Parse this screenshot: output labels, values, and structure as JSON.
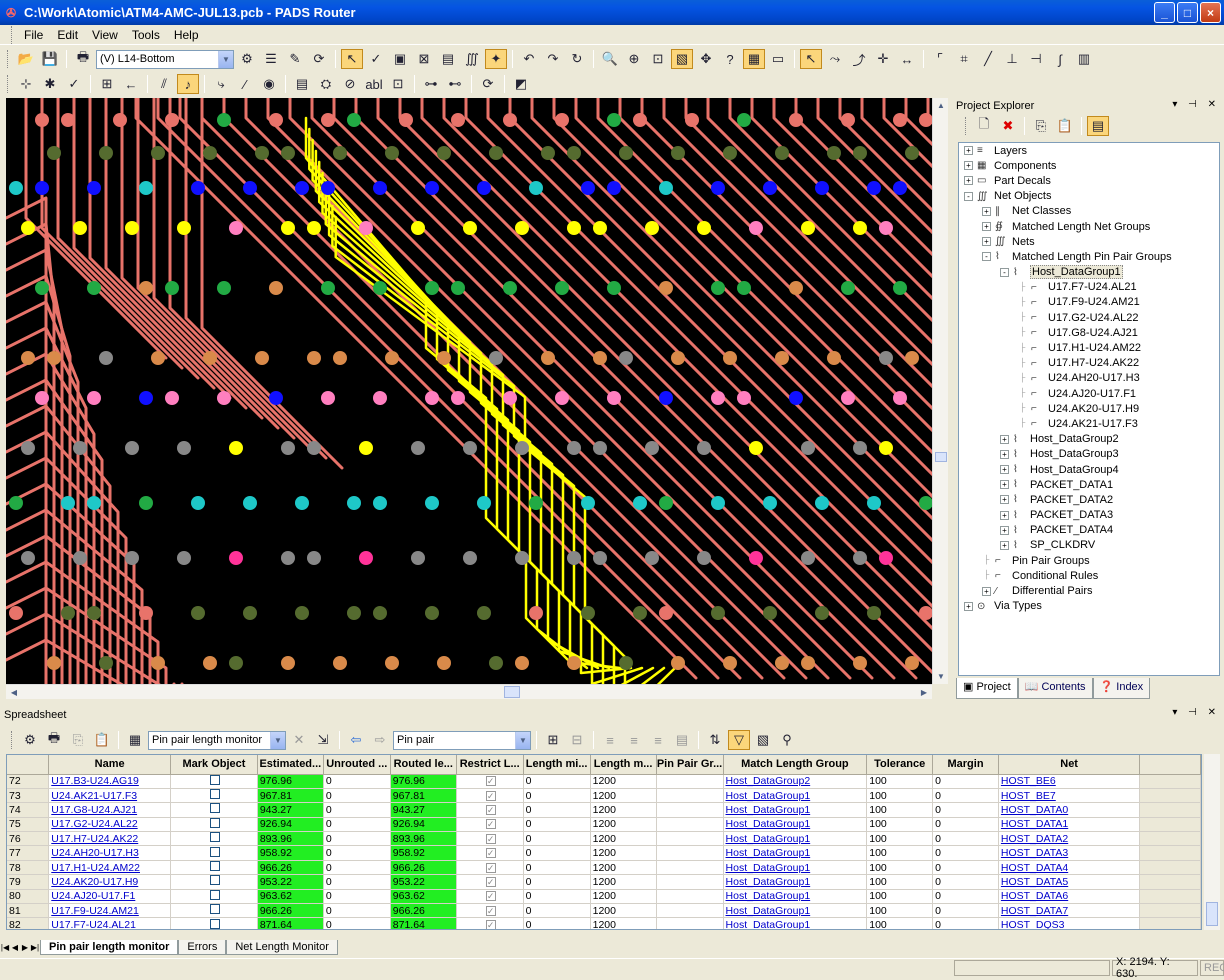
{
  "window": {
    "title": "C:\\Work\\Atomic\\ATM4-AMC-JUL13.pcb - PADS Router",
    "min": "_",
    "max": "□",
    "close": "×"
  },
  "menu": [
    "File",
    "Edit",
    "View",
    "Tools",
    "Help"
  ],
  "layer_combo": {
    "value": "(V) L14-Bottom"
  },
  "project_explorer": {
    "title": "Project Explorer",
    "tree": [
      {
        "level": 0,
        "exp": "+",
        "icon": "layers-icon",
        "glyph": "≡",
        "label": "Layers"
      },
      {
        "level": 0,
        "exp": "+",
        "icon": "components-icon",
        "glyph": "▦",
        "label": "Components"
      },
      {
        "level": 0,
        "exp": "+",
        "icon": "part-decals-icon",
        "glyph": "▭",
        "label": "Part Decals"
      },
      {
        "level": 0,
        "exp": "-",
        "icon": "net-objects-icon",
        "glyph": "∭",
        "label": "Net Objects"
      },
      {
        "level": 1,
        "exp": "+",
        "icon": "net-classes-icon",
        "glyph": "∥",
        "label": "Net Classes"
      },
      {
        "level": 1,
        "exp": "+",
        "icon": "ml-net-groups-icon",
        "glyph": "∯",
        "label": "Matched Length Net Groups"
      },
      {
        "level": 1,
        "exp": "+",
        "icon": "nets-icon",
        "glyph": "∭",
        "label": "Nets"
      },
      {
        "level": 1,
        "exp": "-",
        "icon": "ml-pin-pair-groups-icon",
        "glyph": "⌇",
        "label": "Matched Length Pin Pair Groups"
      },
      {
        "level": 2,
        "exp": "-",
        "icon": "pin-pair-group-icon",
        "glyph": "⌇",
        "label": "Host_DataGroup1",
        "selected": true
      },
      {
        "level": 3,
        "exp": "",
        "icon": "pin-pair-icon",
        "glyph": "⌐",
        "label": "U17.F7-U24.AL21"
      },
      {
        "level": 3,
        "exp": "",
        "icon": "pin-pair-icon",
        "glyph": "⌐",
        "label": "U17.F9-U24.AM21"
      },
      {
        "level": 3,
        "exp": "",
        "icon": "pin-pair-icon",
        "glyph": "⌐",
        "label": "U17.G2-U24.AL22"
      },
      {
        "level": 3,
        "exp": "",
        "icon": "pin-pair-icon",
        "glyph": "⌐",
        "label": "U17.G8-U24.AJ21"
      },
      {
        "level": 3,
        "exp": "",
        "icon": "pin-pair-icon",
        "glyph": "⌐",
        "label": "U17.H1-U24.AM22"
      },
      {
        "level": 3,
        "exp": "",
        "icon": "pin-pair-icon",
        "glyph": "⌐",
        "label": "U17.H7-U24.AK22"
      },
      {
        "level": 3,
        "exp": "",
        "icon": "pin-pair-icon",
        "glyph": "⌐",
        "label": "U24.AH20-U17.H3"
      },
      {
        "level": 3,
        "exp": "",
        "icon": "pin-pair-icon",
        "glyph": "⌐",
        "label": "U24.AJ20-U17.F1"
      },
      {
        "level": 3,
        "exp": "",
        "icon": "pin-pair-icon",
        "glyph": "⌐",
        "label": "U24.AK20-U17.H9"
      },
      {
        "level": 3,
        "exp": "",
        "icon": "pin-pair-icon",
        "glyph": "⌐",
        "label": "U24.AK21-U17.F3"
      },
      {
        "level": 2,
        "exp": "+",
        "icon": "pin-pair-group-icon",
        "glyph": "⌇",
        "label": "Host_DataGroup2"
      },
      {
        "level": 2,
        "exp": "+",
        "icon": "pin-pair-group-icon",
        "glyph": "⌇",
        "label": "Host_DataGroup3"
      },
      {
        "level": 2,
        "exp": "+",
        "icon": "pin-pair-group-icon",
        "glyph": "⌇",
        "label": "Host_DataGroup4"
      },
      {
        "level": 2,
        "exp": "+",
        "icon": "pin-pair-group-icon",
        "glyph": "⌇",
        "label": "PACKET_DATA1"
      },
      {
        "level": 2,
        "exp": "+",
        "icon": "pin-pair-group-icon",
        "glyph": "⌇",
        "label": "PACKET_DATA2"
      },
      {
        "level": 2,
        "exp": "+",
        "icon": "pin-pair-group-icon",
        "glyph": "⌇",
        "label": "PACKET_DATA3"
      },
      {
        "level": 2,
        "exp": "+",
        "icon": "pin-pair-group-icon",
        "glyph": "⌇",
        "label": "PACKET_DATA4"
      },
      {
        "level": 2,
        "exp": "+",
        "icon": "pin-pair-group-icon",
        "glyph": "⌇",
        "label": "SP_CLKDRV"
      },
      {
        "level": 1,
        "exp": "",
        "icon": "pin-pair-groups-icon",
        "glyph": "⌐",
        "label": "Pin Pair Groups"
      },
      {
        "level": 1,
        "exp": "",
        "icon": "conditional-rules-icon",
        "glyph": "⌐",
        "label": "Conditional Rules"
      },
      {
        "level": 1,
        "exp": "+",
        "icon": "differential-pairs-icon",
        "glyph": "⁄",
        "label": "Differential Pairs"
      },
      {
        "level": 0,
        "exp": "+",
        "icon": "via-types-icon",
        "glyph": "⊙",
        "label": "Via Types"
      }
    ],
    "tabs": [
      "Project",
      "Contents",
      "Index"
    ]
  },
  "spreadsheet": {
    "title": "Spreadsheet",
    "monitor_combo": "Pin pair length monitor",
    "filter_combo": "Pin pair",
    "columns": [
      "",
      "Name",
      "Mark Object",
      "Estimated...",
      "Unrouted ...",
      "Routed le...",
      "Restrict L...",
      "Length mi...",
      "Length m...",
      "Pin Pair Gr...",
      "Match Length Group",
      "Tolerance",
      "Margin",
      "Net"
    ],
    "rows": [
      [
        "72",
        "U17.B3-U24.AG19",
        "",
        "976.96",
        "0",
        "976.96",
        "✓",
        "0",
        "1200",
        "",
        "Host_DataGroup2",
        "100",
        "0",
        "HOST_BE6"
      ],
      [
        "73",
        "U24.AK21-U17.F3",
        "",
        "967.81",
        "0",
        "967.81",
        "✓",
        "0",
        "1200",
        "",
        "Host_DataGroup1",
        "100",
        "0",
        "HOST_BE7"
      ],
      [
        "74",
        "U17.G8-U24.AJ21",
        "",
        "943.27",
        "0",
        "943.27",
        "✓",
        "0",
        "1200",
        "",
        "Host_DataGroup1",
        "100",
        "0",
        "HOST_DATA0"
      ],
      [
        "75",
        "U17.G2-U24.AL22",
        "",
        "926.94",
        "0",
        "926.94",
        "✓",
        "0",
        "1200",
        "",
        "Host_DataGroup1",
        "100",
        "0",
        "HOST_DATA1"
      ],
      [
        "76",
        "U17.H7-U24.AK22",
        "",
        "893.96",
        "0",
        "893.96",
        "✓",
        "0",
        "1200",
        "",
        "Host_DataGroup1",
        "100",
        "0",
        "HOST_DATA2"
      ],
      [
        "77",
        "U24.AH20-U17.H3",
        "",
        "958.92",
        "0",
        "958.92",
        "✓",
        "0",
        "1200",
        "",
        "Host_DataGroup1",
        "100",
        "0",
        "HOST_DATA3"
      ],
      [
        "78",
        "U17.H1-U24.AM22",
        "",
        "966.26",
        "0",
        "966.26",
        "✓",
        "0",
        "1200",
        "",
        "Host_DataGroup1",
        "100",
        "0",
        "HOST_DATA4"
      ],
      [
        "79",
        "U24.AK20-U17.H9",
        "",
        "953.22",
        "0",
        "953.22",
        "✓",
        "0",
        "1200",
        "",
        "Host_DataGroup1",
        "100",
        "0",
        "HOST_DATA5"
      ],
      [
        "80",
        "U24.AJ20-U17.F1",
        "",
        "963.62",
        "0",
        "963.62",
        "✓",
        "0",
        "1200",
        "",
        "Host_DataGroup1",
        "100",
        "0",
        "HOST_DATA6"
      ],
      [
        "81",
        "U17.F9-U24.AM21",
        "",
        "966.26",
        "0",
        "966.26",
        "✓",
        "0",
        "1200",
        "",
        "Host_DataGroup1",
        "100",
        "0",
        "HOST_DATA7"
      ],
      [
        "82",
        "U17.F7-U24.AL21",
        "",
        "871.64",
        "0",
        "871.64",
        "✓",
        "0",
        "1200",
        "",
        "Host_DataGroup1",
        "100",
        "0",
        "HOST_DQS3"
      ]
    ],
    "tabs": [
      "Pin pair length monitor",
      "Errors",
      "Net Length Monitor"
    ]
  },
  "status": {
    "coords": "X: 2194.  Y: 630.",
    "rec": "REC"
  },
  "colors": {
    "trace": "#e8736a",
    "highlight": "#ffff00",
    "board": "#000000",
    "routed_cell": "#22ee22"
  }
}
